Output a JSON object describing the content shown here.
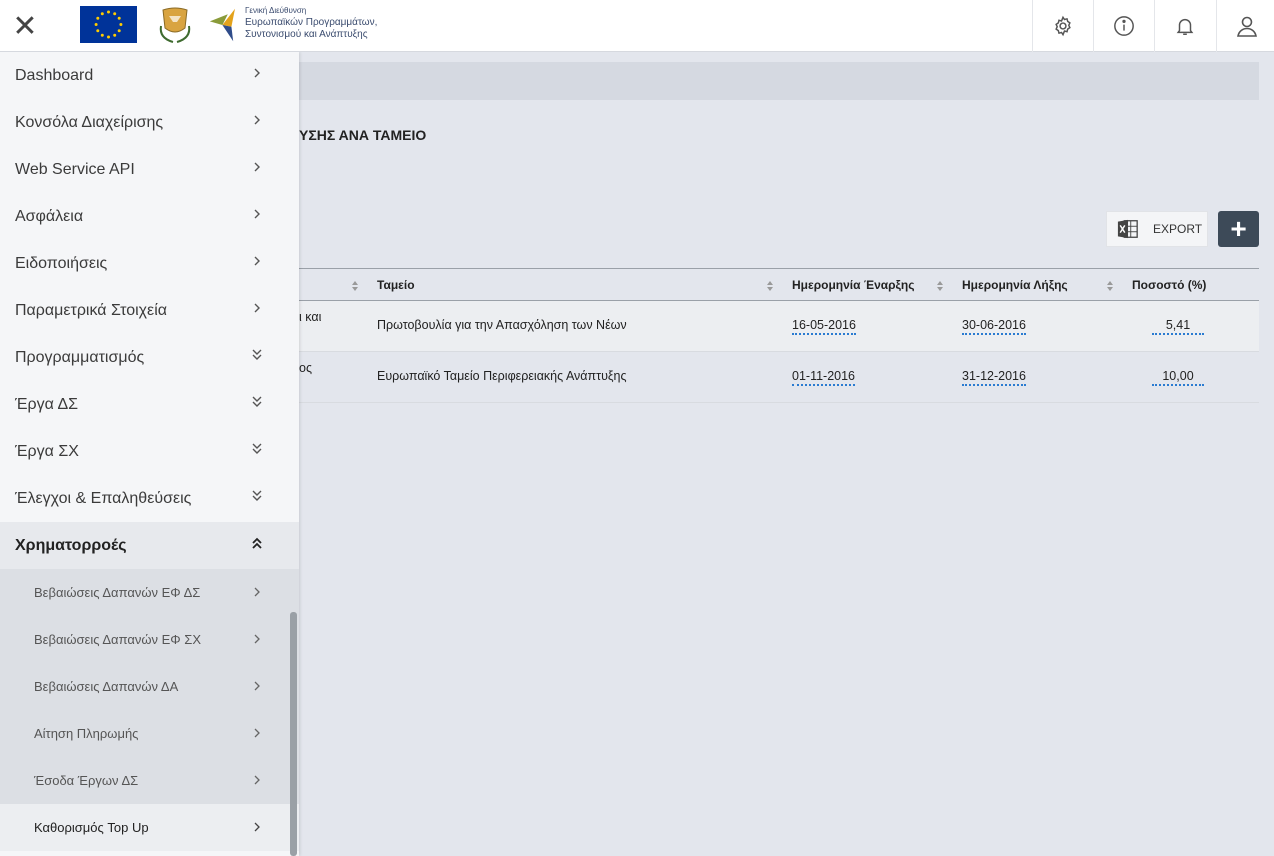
{
  "header": {
    "logo_text_small": "Γενική Διεύθυνση",
    "logo_text_line1": "Ευρωπαϊκών Προγραμμάτων,",
    "logo_text_line2": "Συντονισμού και Ανάπτυξης"
  },
  "sidebar": {
    "items": [
      {
        "label": "Dashboard",
        "chevron": "right"
      },
      {
        "label": "Κονσόλα Διαχείρισης",
        "chevron": "right"
      },
      {
        "label": "Web Service API",
        "chevron": "right"
      },
      {
        "label": "Ασφάλεια",
        "chevron": "right"
      },
      {
        "label": "Ειδοποιήσεις",
        "chevron": "right"
      },
      {
        "label": "Παραμετρικά Στοιχεία",
        "chevron": "right"
      },
      {
        "label": "Προγραμματισμός",
        "chevron": "double-down"
      },
      {
        "label": "Έργα ΔΣ",
        "chevron": "double-down"
      },
      {
        "label": "Έργα ΣΧ",
        "chevron": "double-down"
      },
      {
        "label": "Έλεγχοι & Επαληθεύσεις",
        "chevron": "double-down"
      },
      {
        "label": "Χρηματορροές",
        "chevron": "double-up"
      }
    ],
    "subitems": [
      {
        "label": "Βεβαιώσεις Δαπανών ΕΦ ΔΣ"
      },
      {
        "label": "Βεβαιώσεις Δαπανών ΕΦ ΣΧ"
      },
      {
        "label": "Βεβαιώσεις Δαπανών ΔΑ"
      },
      {
        "label": "Αίτηση Πληρωμής"
      },
      {
        "label": "Έσοδα Έργων ΔΣ"
      },
      {
        "label": "Καθορισμός Top Up"
      }
    ]
  },
  "main": {
    "title_visible": "ΥΣΗΣ ΑΝΑ ΤΑΜΕΙΟ",
    "export_label": "EXPORT",
    "add_label": "+"
  },
  "table": {
    "headers": [
      "Ταμείο",
      "Ημερομηνία Έναρξης",
      "Ημερομηνία Λήξης",
      "Ποσοστό (%)"
    ],
    "rows": [
      {
        "trunc": "ι και",
        "fund": "Πρωτοβουλία για την Απασχόληση των Νέων",
        "start": "16-05-2016",
        "end": "30-06-2016",
        "pct": "5,41"
      },
      {
        "trunc": "ος",
        "fund": "Ευρωπαϊκό Ταμείο Περιφερειακής Ανάπτυξης",
        "start": "01-11-2016",
        "end": "31-12-2016",
        "pct": "10,00"
      }
    ]
  },
  "colors": {
    "accent_dark": "#3d4a58",
    "link_dotted": "#2a7bd1",
    "eu_blue": "#003399"
  }
}
